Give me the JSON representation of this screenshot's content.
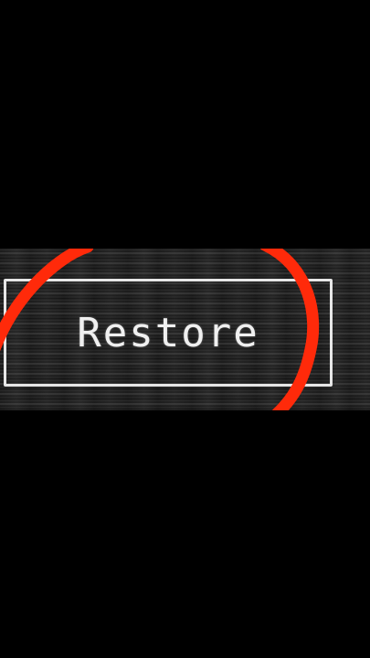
{
  "screen": {
    "background_color": "#000000"
  },
  "button": {
    "label": "Restore",
    "border_color": "#e6e6e6",
    "text_color": "#f0f0f0"
  },
  "annotation": {
    "type": "circle-highlight",
    "color": "#ff2a0a"
  }
}
